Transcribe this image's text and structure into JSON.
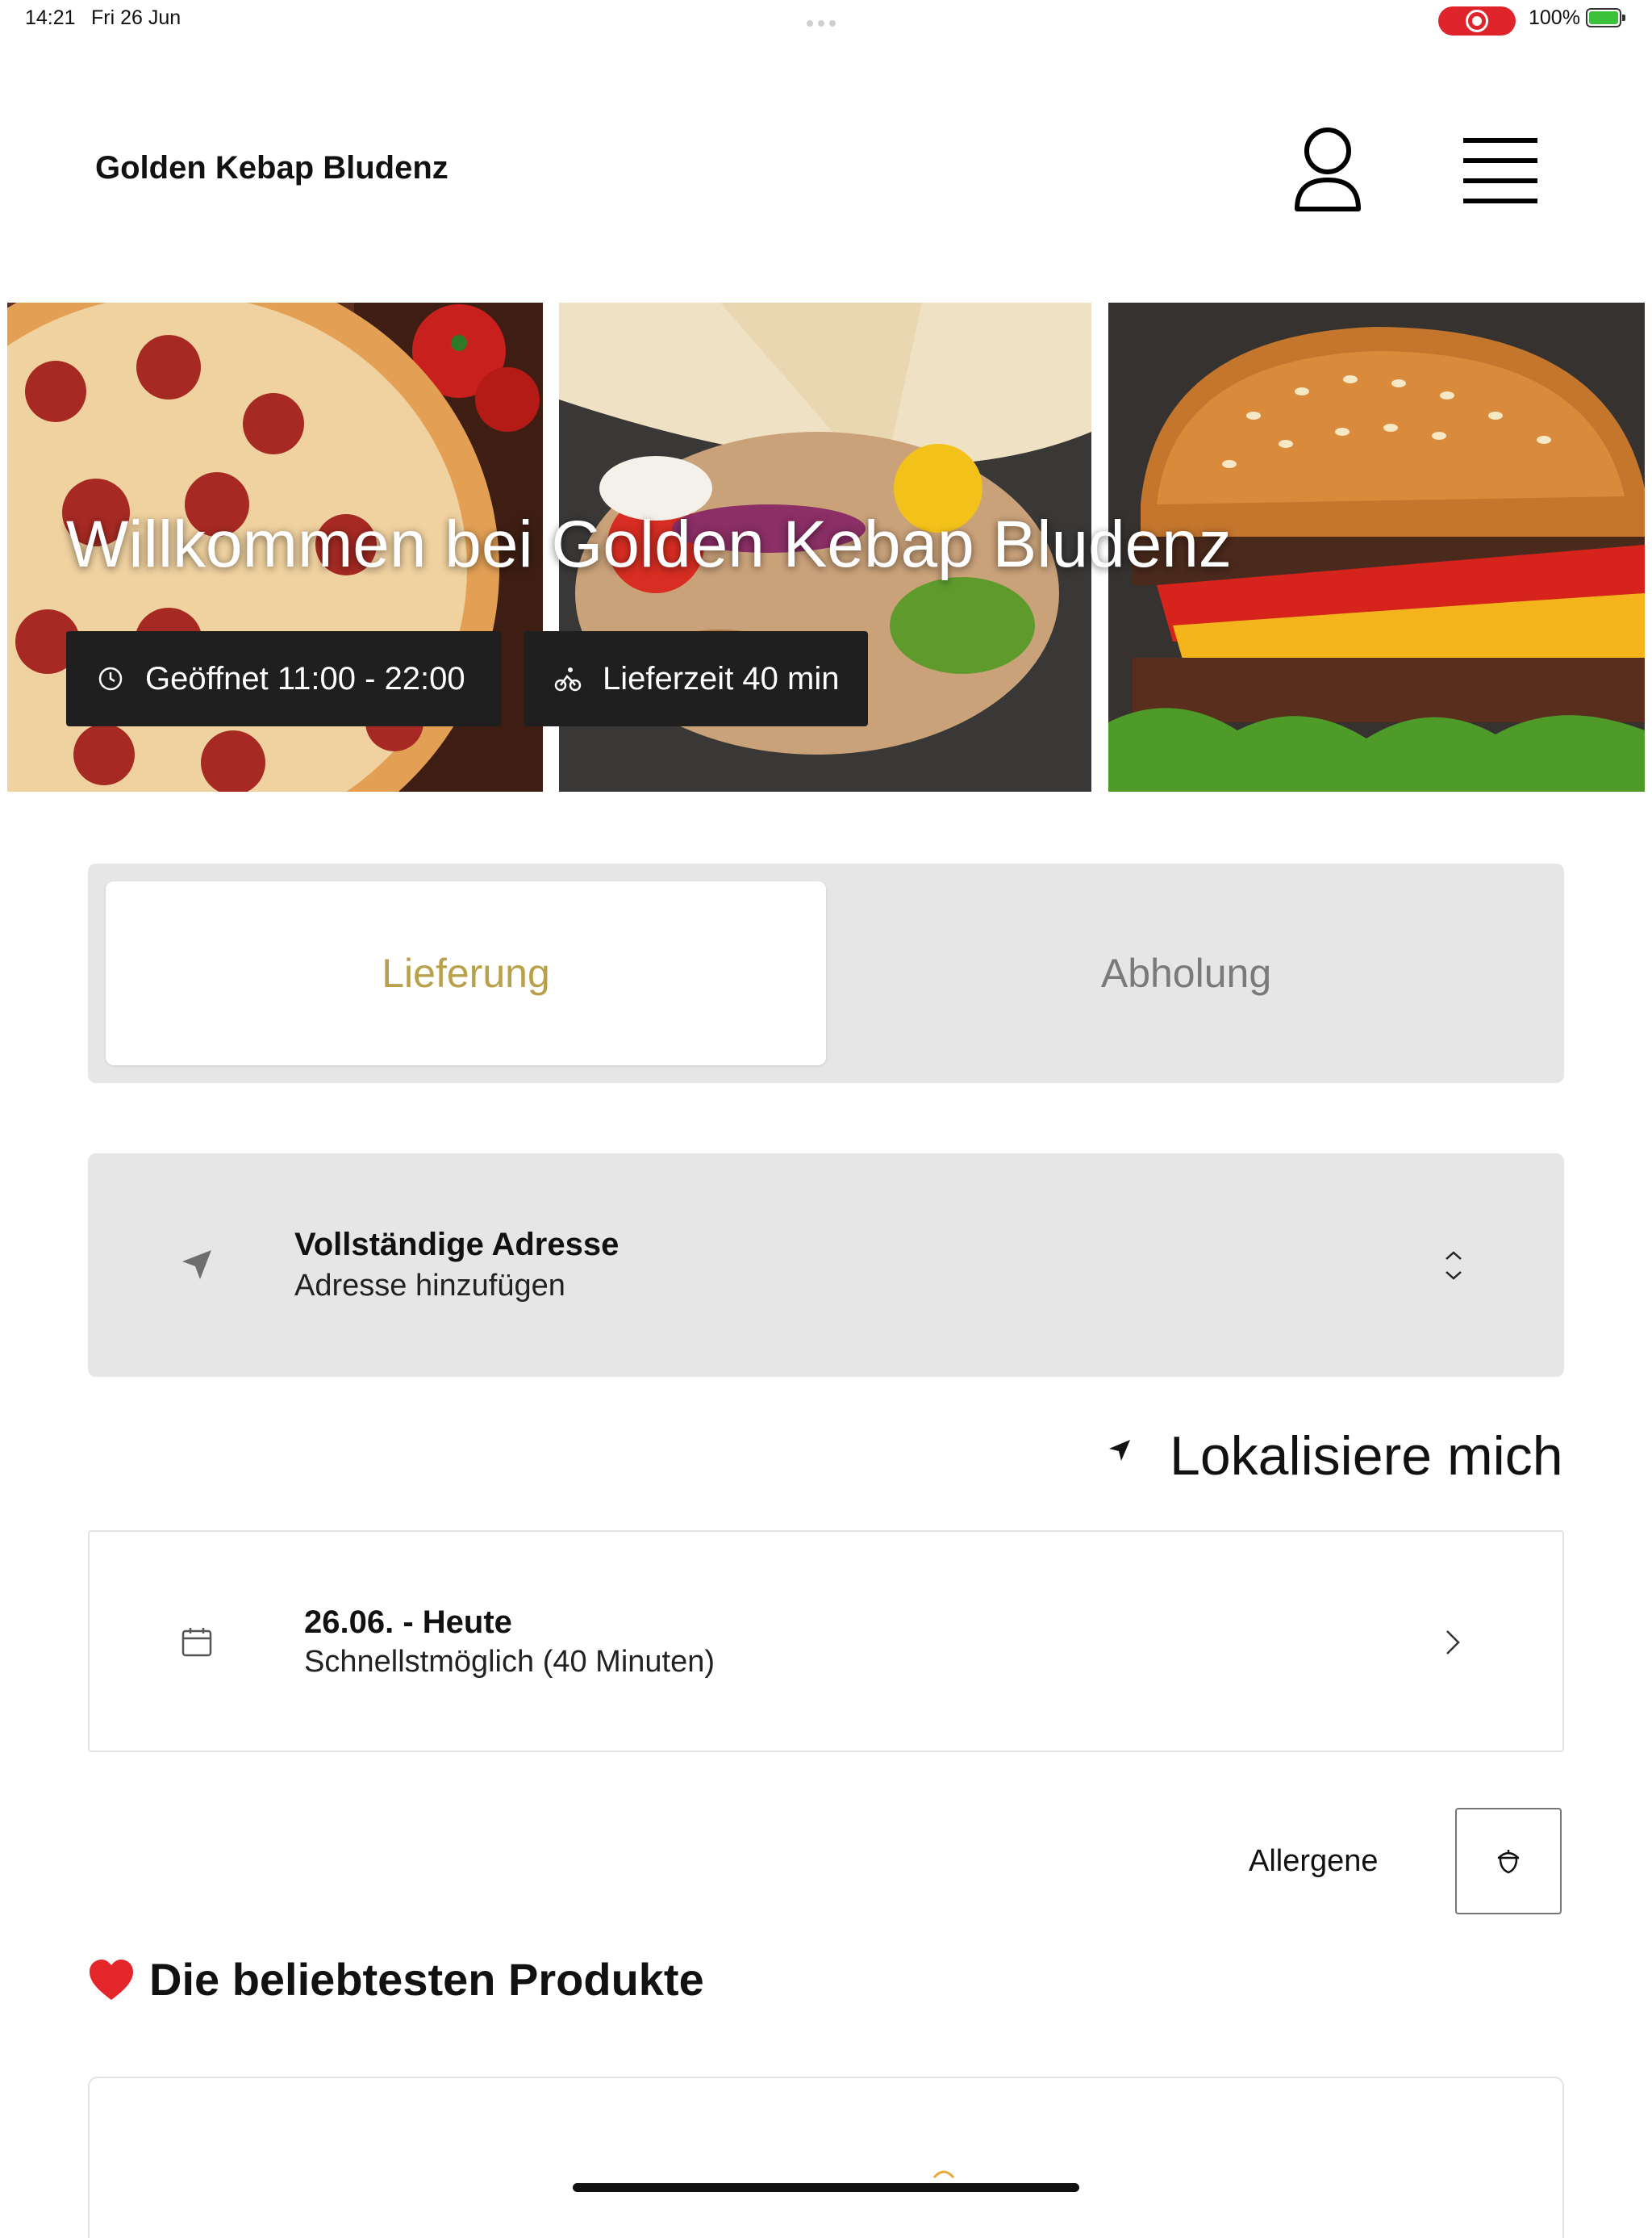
{
  "status_bar": {
    "time": "14:21",
    "date": "Fri 26 Jun",
    "battery": "100%",
    "recording_indicator_color": "#e0242b",
    "battery_color": "#3cc13b"
  },
  "header": {
    "title": "Golden Kebap Bludenz",
    "user_icon": "user-icon",
    "menu_icon": "hamburger-menu-icon"
  },
  "hero": {
    "title": "Willkommen bei Golden Kebap Bludenz",
    "opening_hours": "Geöffnet 11:00 - 22:00",
    "delivery_time": "Lieferzeit 40 min",
    "images": [
      "pizza",
      "wrap",
      "burger"
    ]
  },
  "order_mode": {
    "tabs": [
      {
        "label": "Lieferung",
        "selected": true
      },
      {
        "label": "Abholung",
        "selected": false
      }
    ],
    "accent_color": "#b9a04b"
  },
  "address": {
    "title": "Vollständige Adresse",
    "value": "Adresse hinzufügen"
  },
  "locate_label": "Lokalisiere mich",
  "schedule": {
    "title": "26.06. - Heute",
    "value": "Schnellstmöglich (40 Minuten)"
  },
  "allergens_label": "Allergene",
  "popular_heading": "Die beliebtesten Produkte"
}
